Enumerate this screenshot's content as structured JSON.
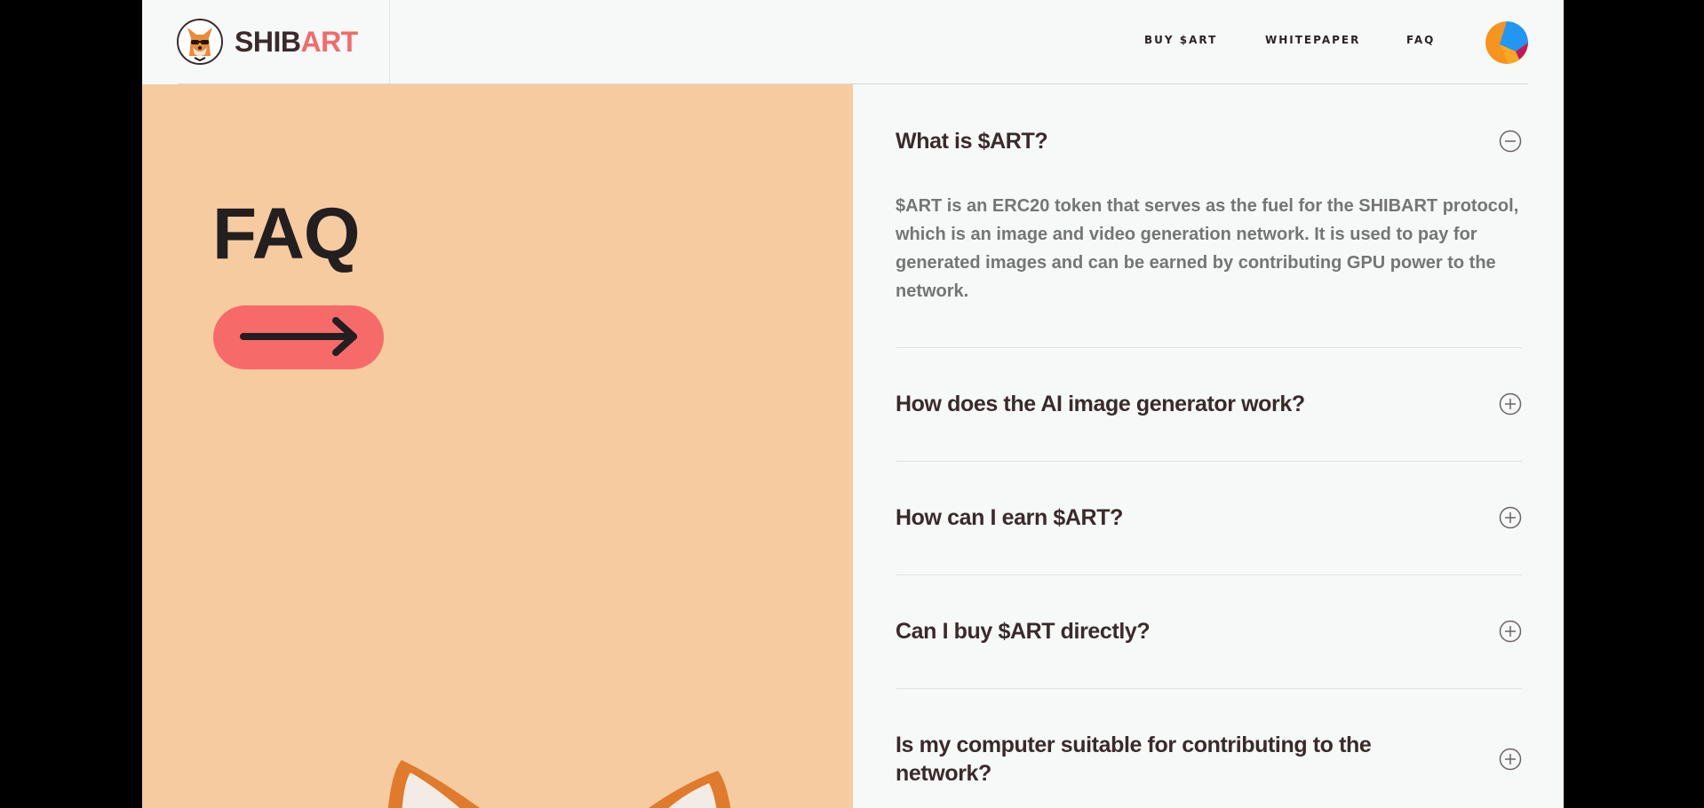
{
  "header": {
    "logo": {
      "part1": "SHIB",
      "part2": "ART",
      "icon": "shiba-dog-logo-icon"
    },
    "nav": [
      {
        "label": "BUY $ART"
      },
      {
        "label": "WHITEPAPER"
      },
      {
        "label": "FAQ"
      }
    ],
    "wallet_icon": "wallet-avatar-icon"
  },
  "hero": {
    "title": "FAQ",
    "arrow_button_icon": "arrow-right-icon"
  },
  "faq": {
    "items": [
      {
        "question": "What is $ART?",
        "answer": "$ART is an ERC20 token that serves as the fuel for the SHIBART protocol, which is an image and video generation network. It is used to pay for generated images and can be earned by contributing GPU power to the network.",
        "expanded": true,
        "toggle_icon": "minus-circle-icon"
      },
      {
        "question": "How does the AI image generator work?",
        "expanded": false,
        "toggle_icon": "plus-circle-icon"
      },
      {
        "question": "How can I earn $ART?",
        "expanded": false,
        "toggle_icon": "plus-circle-icon"
      },
      {
        "question": "Can I buy $ART directly?",
        "expanded": false,
        "toggle_icon": "plus-circle-icon"
      },
      {
        "question": "Is my computer suitable for contributing to the network?",
        "expanded": false,
        "toggle_icon": "plus-circle-icon"
      }
    ]
  },
  "colors": {
    "accent": "#f76a6a",
    "left_panel_bg": "#f7cba0",
    "page_bg": "#f6f9f8",
    "text_dark": "#3a2a2c",
    "text_muted": "#757575"
  }
}
